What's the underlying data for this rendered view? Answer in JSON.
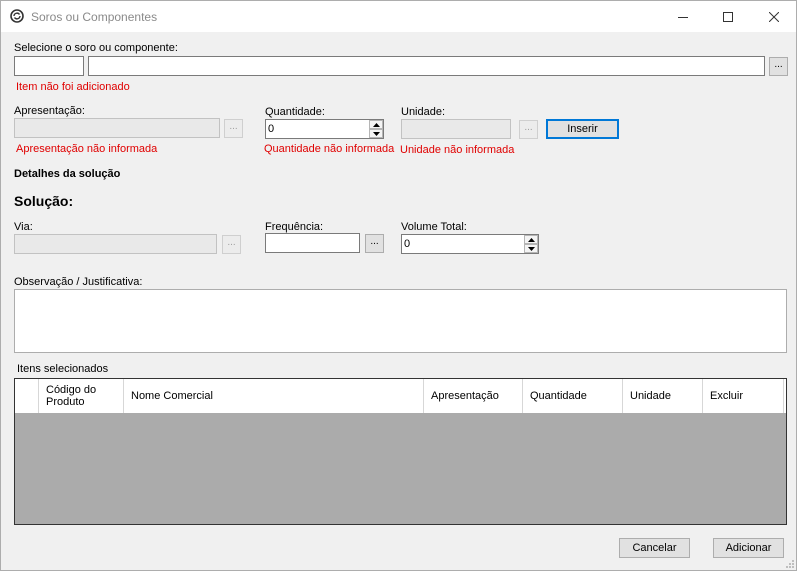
{
  "window": {
    "title": "Soros ou Componentes"
  },
  "component": {
    "label": "Selecione o soro ou componente:",
    "code_value": "",
    "name_value": "",
    "browse_label": "...",
    "error": "Item não foi adicionado"
  },
  "presentation": {
    "label": "Apresentação:",
    "value": "",
    "browse_label": "...",
    "error": "Apresentação não informada"
  },
  "quantity": {
    "label": "Quantidade:",
    "value": "0",
    "error": "Quantidade não informada"
  },
  "unit": {
    "label": "Unidade:",
    "value": "",
    "browse_label": "...",
    "error": "Unidade não informada"
  },
  "insert_button": "Inserir",
  "details": {
    "title": "Detalhes da solução",
    "solution_label": "Solução:"
  },
  "route": {
    "label": "Via:",
    "value": "",
    "browse_label": "..."
  },
  "frequency": {
    "label": "Frequência:",
    "value": "",
    "browse_label": "..."
  },
  "total_volume": {
    "label": "Volume Total:",
    "value": "0"
  },
  "observation": {
    "label": "Observação / Justificativa:",
    "value": ""
  },
  "items": {
    "label": "Itens selecionados",
    "columns": [
      "Código do Produto",
      "Nome Comercial",
      "Apresentação",
      "Quantidade",
      "Unidade",
      "Excluir"
    ]
  },
  "footer": {
    "cancel": "Cancelar",
    "add": "Adicionar"
  },
  "colors": {
    "error": "#e00000",
    "accent": "#0078d7",
    "grid_bg": "#ababab"
  }
}
